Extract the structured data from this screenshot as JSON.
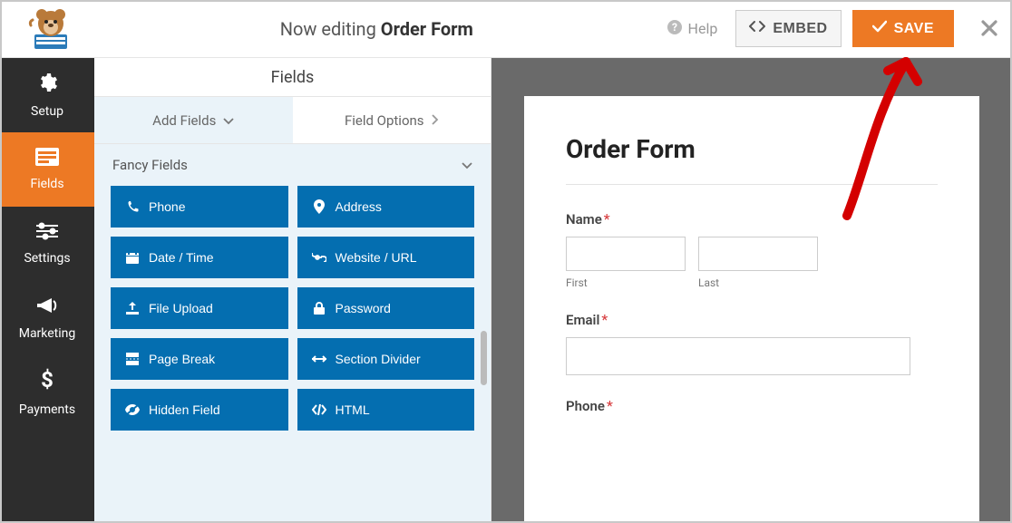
{
  "header": {
    "editing_prefix": "Now editing ",
    "editing_title": "Order Form",
    "help_label": "Help",
    "embed_label": "EMBED",
    "save_label": "SAVE"
  },
  "sidebar": {
    "items": [
      {
        "label": "Setup"
      },
      {
        "label": "Fields"
      },
      {
        "label": "Settings"
      },
      {
        "label": "Marketing"
      },
      {
        "label": "Payments"
      }
    ]
  },
  "panel": {
    "header": "Fields",
    "tab_add": "Add Fields",
    "tab_options": "Field Options",
    "section_title": "Fancy Fields",
    "fields": [
      {
        "label": "Phone"
      },
      {
        "label": "Address"
      },
      {
        "label": "Date / Time"
      },
      {
        "label": "Website / URL"
      },
      {
        "label": "File Upload"
      },
      {
        "label": "Password"
      },
      {
        "label": "Page Break"
      },
      {
        "label": "Section Divider"
      },
      {
        "label": "Hidden Field"
      },
      {
        "label": "HTML"
      }
    ]
  },
  "preview": {
    "title": "Order Form",
    "name_label": "Name",
    "first_label": "First",
    "last_label": "Last",
    "email_label": "Email",
    "phone_label": "Phone",
    "required_marker": "*"
  }
}
